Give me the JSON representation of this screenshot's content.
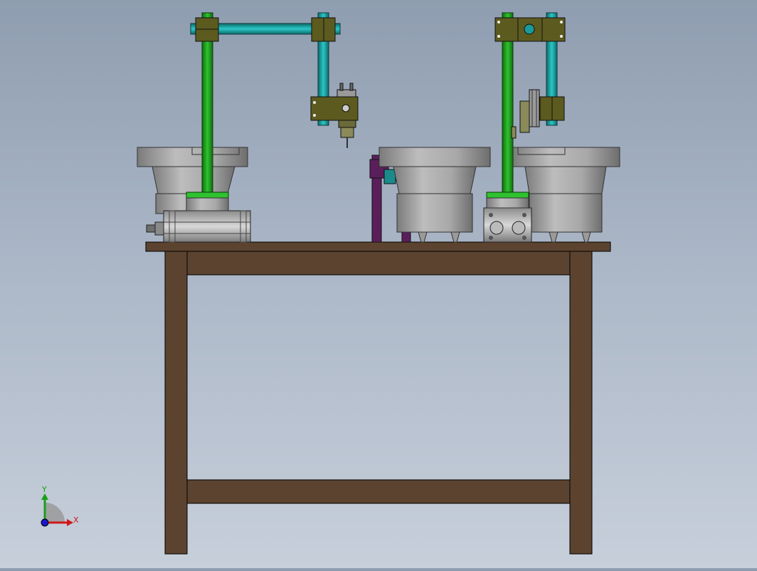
{
  "viewport": {
    "background_top": "#8f9db0",
    "background_bottom": "#c7cfdb"
  },
  "colors": {
    "table_wood": "#5b4330",
    "green_column": "#1f9a1f",
    "teal_column": "#1a9a9a",
    "clamp_olive": "#5c5a1f",
    "bowl_gray": "#9a9a9a",
    "purple_bracket": "#5a1f5a"
  },
  "triad": {
    "x_label": "X",
    "y_label": "Y",
    "x_color": "#d01818",
    "y_color": "#18a018",
    "z_color": "#1818c8"
  }
}
